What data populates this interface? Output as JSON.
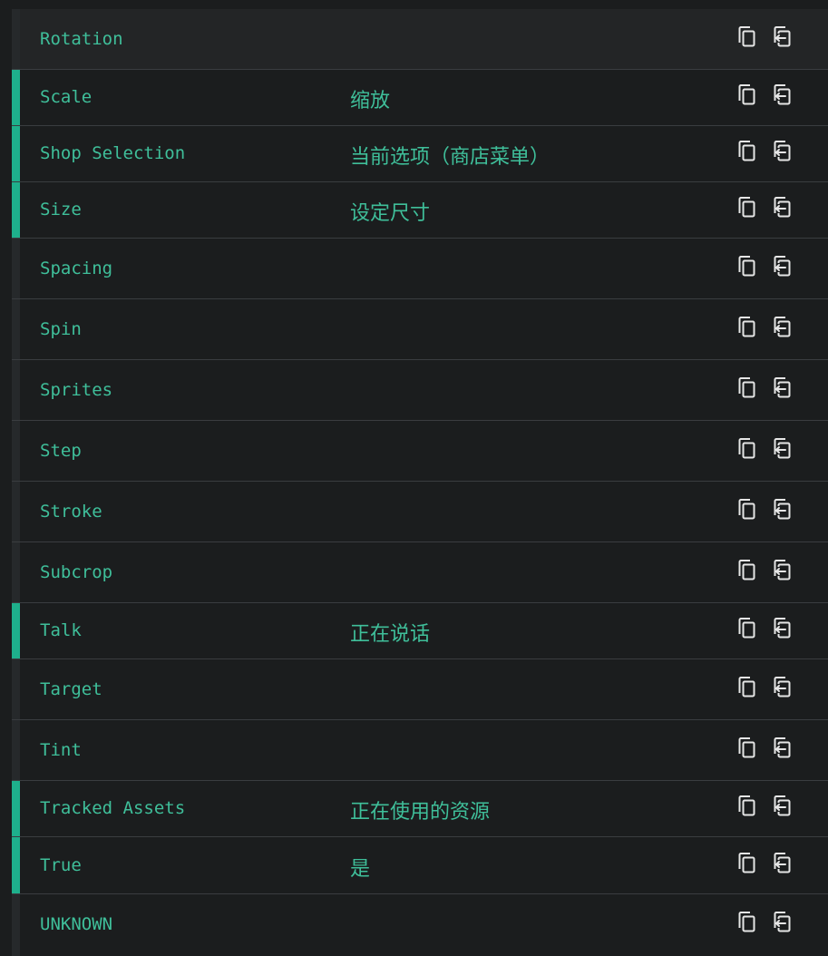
{
  "colors": {
    "accent_translated": "#1eb08c",
    "text": "#3fbf9a",
    "divider": "#3a3d40",
    "background": "#1b1d1e"
  },
  "icons": {
    "copy": "copy-icon",
    "paste": "paste-icon"
  },
  "rows": [
    {
      "key": "Rotation",
      "value": "",
      "translated": false,
      "hover": true
    },
    {
      "key": "Scale",
      "value": "缩放",
      "translated": true
    },
    {
      "key": "Shop Selection",
      "value": "当前选项（商店菜单）",
      "translated": true
    },
    {
      "key": "Size",
      "value": "设定尺寸",
      "translated": true
    },
    {
      "key": "Spacing",
      "value": "",
      "translated": false
    },
    {
      "key": "Spin",
      "value": "",
      "translated": false
    },
    {
      "key": "Sprites",
      "value": "",
      "translated": false
    },
    {
      "key": "Step",
      "value": "",
      "translated": false
    },
    {
      "key": "Stroke",
      "value": "",
      "translated": false
    },
    {
      "key": "Subcrop",
      "value": "",
      "translated": false
    },
    {
      "key": "Talk",
      "value": "正在说话",
      "translated": true
    },
    {
      "key": "Target",
      "value": "",
      "translated": false
    },
    {
      "key": "Tint",
      "value": "",
      "translated": false
    },
    {
      "key": "Tracked Assets",
      "value": "正在使用的资源",
      "translated": true
    },
    {
      "key": "True",
      "value": "是",
      "translated": true
    },
    {
      "key": "UNKNOWN",
      "value": "",
      "translated": false
    }
  ]
}
